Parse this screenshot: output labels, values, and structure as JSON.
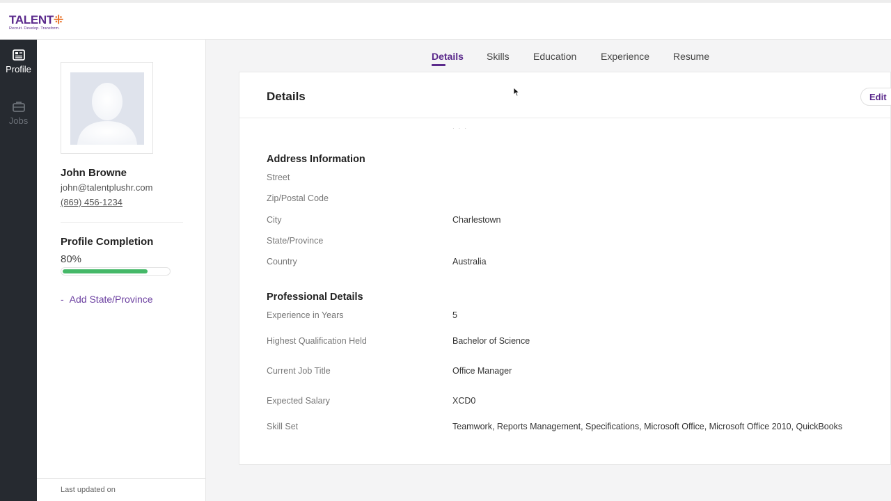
{
  "brand": {
    "word": "TALENT",
    "cross": "⁜",
    "tagline": "Recruit. Develop. Transform.",
    "primary_color": "#5b2a8c",
    "accent_color": "#e8732b"
  },
  "rail": {
    "items": [
      {
        "label": "Profile",
        "icon": "profile-icon",
        "active": true
      },
      {
        "label": "Jobs",
        "icon": "briefcase-icon",
        "active": false
      }
    ]
  },
  "profile": {
    "name": "John Browne",
    "email": "john@talentplushr.com",
    "phone": "(869) 456-1234",
    "completion_title": "Profile Completion",
    "completion_value": "80%",
    "completion_fraction": 0.8,
    "completion_color": "#45b868",
    "suggestion_prefix": "-",
    "suggestion": "Add State/Province",
    "last_updated": "Last updated on"
  },
  "tabs": [
    {
      "label": "Details",
      "active": true
    },
    {
      "label": "Skills",
      "active": false
    },
    {
      "label": "Education",
      "active": false
    },
    {
      "label": "Experience",
      "active": false
    },
    {
      "label": "Resume",
      "active": false
    }
  ],
  "card": {
    "title": "Details",
    "edit_label": "Edit"
  },
  "address": {
    "title": "Address Information",
    "fields": [
      {
        "label": "Street",
        "value": ""
      },
      {
        "label": "Zip/Postal Code",
        "value": ""
      },
      {
        "label": "City",
        "value": "Charlestown"
      },
      {
        "label": "State/Province",
        "value": ""
      },
      {
        "label": "Country",
        "value": "Australia"
      }
    ]
  },
  "professional": {
    "title": "Professional Details",
    "fields": [
      {
        "label": "Experience in Years",
        "value": "5"
      },
      {
        "label": "Highest Qualification Held",
        "value": "Bachelor of Science"
      },
      {
        "label": "Current Job Title",
        "value": "Office Manager"
      },
      {
        "label": "Expected Salary",
        "value": "XCD0"
      },
      {
        "label": "Skill Set",
        "value": "Teamwork, Reports Management, Specifications, Microsoft Office, Microsoft Office 2010, QuickBooks"
      }
    ]
  }
}
